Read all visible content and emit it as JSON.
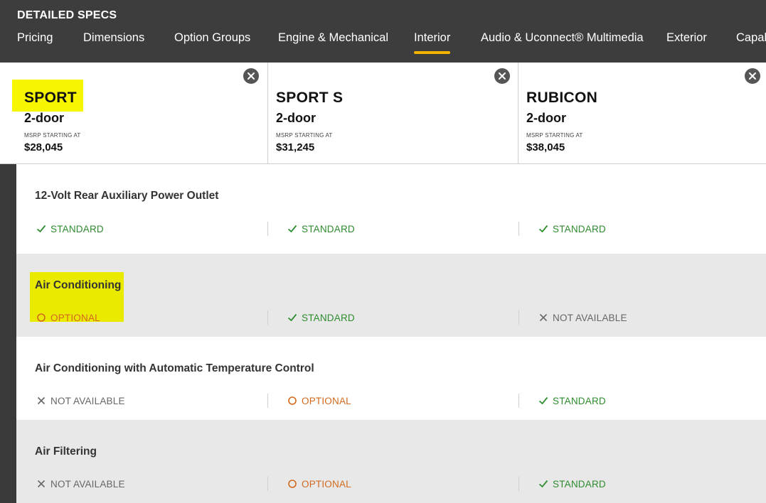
{
  "header": {
    "title": "DETAILED SPECS",
    "tabs": [
      {
        "label": "Pricing",
        "active": false
      },
      {
        "label": "Dimensions",
        "active": false
      },
      {
        "label": "Option Groups",
        "active": false
      },
      {
        "label": "Engine & Mechanical",
        "active": false
      },
      {
        "label": "Interior",
        "active": true
      },
      {
        "label": "Audio & Uconnect® Multimedia",
        "active": false
      },
      {
        "label": "Exterior",
        "active": false
      },
      {
        "label": "Capab",
        "active": false
      }
    ],
    "accent_color": "#f5b300"
  },
  "trims": [
    {
      "name": "SPORT",
      "doors": "2-door",
      "msrp_label": "MSRP STARTING AT",
      "price": "$28,045"
    },
    {
      "name": "SPORT S",
      "doors": "2-door",
      "msrp_label": "MSRP STARTING AT",
      "price": "$31,245"
    },
    {
      "name": "RUBICON",
      "doors": "2-door",
      "msrp_label": "MSRP STARTING AT",
      "price": "$38,045"
    }
  ],
  "icons": {
    "close": "close-icon",
    "standard": "check-icon",
    "optional": "circle-icon",
    "not_available": "x-icon"
  },
  "status_colors": {
    "standard": "#2e8b2e",
    "optional": "#d2691e",
    "not_available": "#666666",
    "highlight": "#f6f600"
  },
  "features": [
    {
      "title": "12-Volt Rear Auxiliary Power Outlet",
      "values": [
        {
          "status": "standard",
          "label": "STANDARD"
        },
        {
          "status": "standard",
          "label": "STANDARD"
        },
        {
          "status": "standard",
          "label": "STANDARD"
        }
      ]
    },
    {
      "title": "Air Conditioning",
      "values": [
        {
          "status": "optional",
          "label": "OPTIONAL"
        },
        {
          "status": "standard",
          "label": "STANDARD"
        },
        {
          "status": "na",
          "label": "NOT AVAILABLE"
        }
      ]
    },
    {
      "title": "Air Conditioning with Automatic Temperature Control",
      "values": [
        {
          "status": "na",
          "label": "NOT AVAILABLE"
        },
        {
          "status": "optional",
          "label": "OPTIONAL"
        },
        {
          "status": "standard",
          "label": "STANDARD"
        }
      ]
    },
    {
      "title": "Air Filtering",
      "values": [
        {
          "status": "na",
          "label": "NOT AVAILABLE"
        },
        {
          "status": "optional",
          "label": "OPTIONAL"
        },
        {
          "status": "standard",
          "label": "STANDARD"
        }
      ]
    }
  ]
}
